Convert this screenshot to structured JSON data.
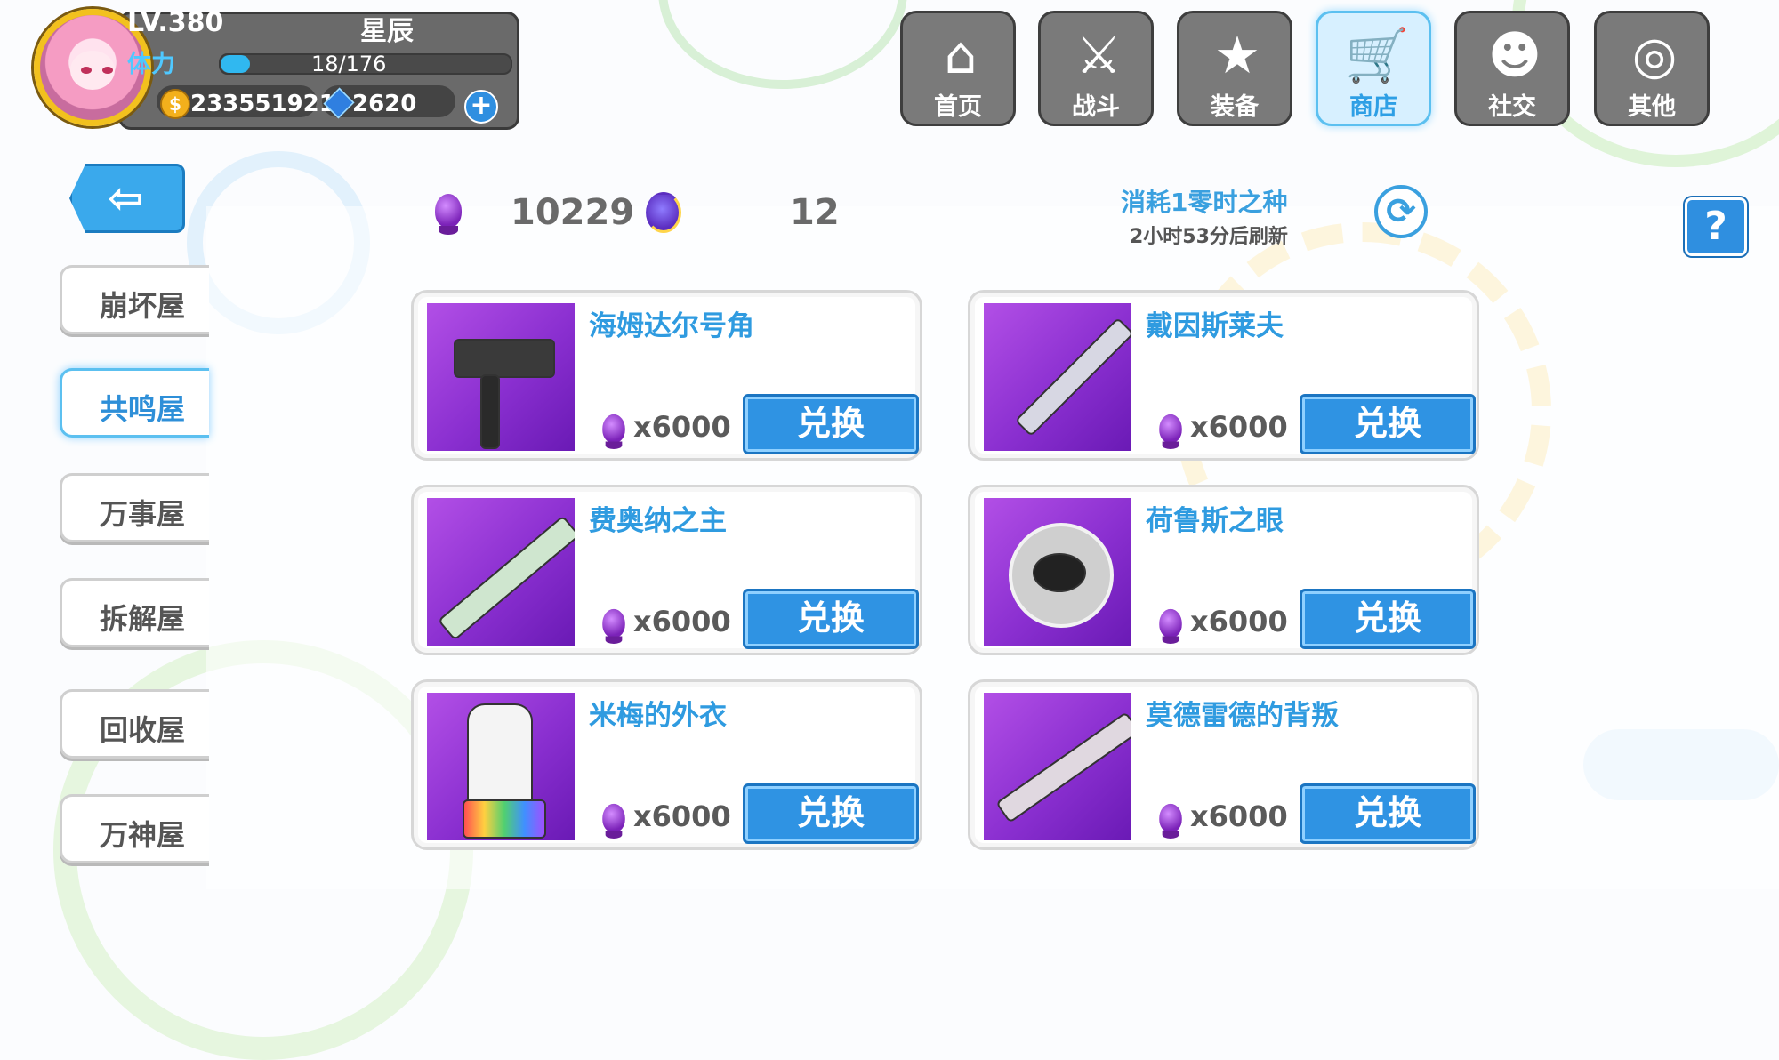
{
  "player": {
    "level": "LV.380",
    "name": "星辰",
    "stamina_label": "体力",
    "stamina_text": "18/176",
    "stamina_fraction": 0.102,
    "gold": "233551921",
    "gems": "2620",
    "coin_symbol": "$"
  },
  "nav": [
    {
      "label": "首页",
      "icon": "home-icon"
    },
    {
      "label": "战斗",
      "icon": "battle-icon"
    },
    {
      "label": "装备",
      "icon": "equipment-icon"
    },
    {
      "label": "商店",
      "icon": "shop-icon",
      "active": true
    },
    {
      "label": "社交",
      "icon": "social-icon"
    },
    {
      "label": "其他",
      "icon": "other-icon"
    }
  ],
  "side_tabs": [
    {
      "label": "崩坏屋"
    },
    {
      "label": "共鸣屋",
      "active": true
    },
    {
      "label": "万事屋"
    },
    {
      "label": "拆解屋"
    },
    {
      "label": "回收屋"
    },
    {
      "label": "万神屋"
    }
  ],
  "currency": {
    "crystals": "10229",
    "seeds": "12"
  },
  "refresh": {
    "cost": "消耗1零时之种",
    "timer": "2小时53分后刷新"
  },
  "help_label": "?",
  "items": [
    {
      "name": "海姆达尔号角",
      "price": "x6000",
      "button": "兑换"
    },
    {
      "name": "戴因斯莱夫",
      "price": "x6000",
      "button": "兑换"
    },
    {
      "name": "费奥纳之主",
      "price": "x6000",
      "button": "兑换"
    },
    {
      "name": "荷鲁斯之眼",
      "price": "x6000",
      "button": "兑换"
    },
    {
      "name": "米梅的外衣",
      "price": "x6000",
      "button": "兑换"
    },
    {
      "name": "莫德雷德的背叛",
      "price": "x6000",
      "button": "兑换"
    }
  ],
  "colors": {
    "accent": "#2f93e3",
    "item_bg": "#8a2fd0"
  }
}
